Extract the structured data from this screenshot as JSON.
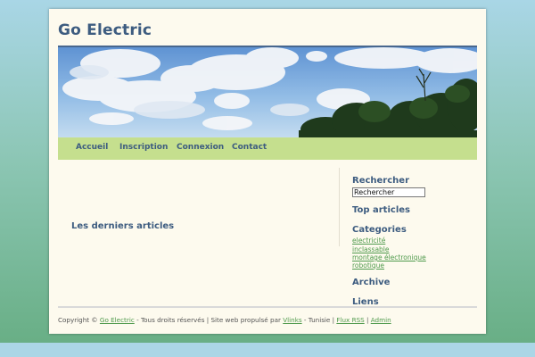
{
  "site": {
    "title": "Go Electric"
  },
  "nav": {
    "items": [
      "Accueil",
      "Inscription",
      "Connexion",
      "Contact"
    ]
  },
  "main": {
    "latest_heading": "Les derniers articles"
  },
  "sidebar": {
    "search_heading": "Rechercher",
    "search_value": "Rechercher",
    "top_heading": "Top articles",
    "categories_heading": "Categories",
    "categories": [
      "electricité",
      "inclassable",
      "montage électronique",
      "robotique"
    ],
    "archive_heading": "Archive",
    "links_heading": "Liens"
  },
  "footer": {
    "copyright": "Copyright ©",
    "site_link": "Go Electric",
    "rights": "- Tous droits réservés | Site web propulsé par",
    "engine_link": "Vlinks",
    "country": "- Tunisie |",
    "rss_link": "Flux RSS",
    "sep": "|",
    "admin_link": "Admin"
  },
  "colors": {
    "title": "#3d5c80",
    "nav_bg": "#c5df8e",
    "link": "#4f9a4c",
    "page_bg": "#fdfaee"
  }
}
